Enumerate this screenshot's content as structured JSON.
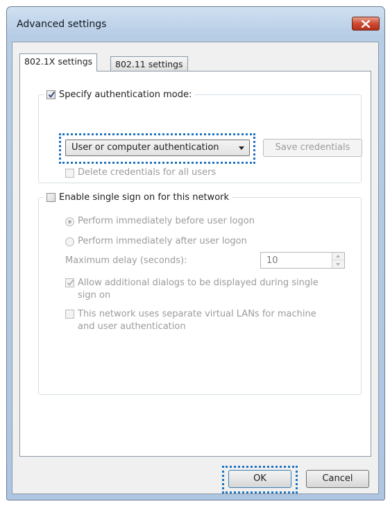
{
  "window": {
    "title": "Advanced settings"
  },
  "tabs": [
    {
      "label": "802.1X settings",
      "active": true
    },
    {
      "label": "802.11 settings",
      "active": false
    }
  ],
  "auth_group": {
    "checkbox_label": "Specify authentication mode:",
    "checked": true,
    "mode_selected": "User or computer authentication",
    "save_credentials_label": "Save credentials",
    "delete_credentials_label": "Delete credentials for all users"
  },
  "sso_group": {
    "checkbox_label": "Enable single sign on for this network",
    "checked": false,
    "radio_before": "Perform immediately before user logon",
    "radio_after": "Perform immediately after user logon",
    "max_delay_label": "Maximum delay (seconds):",
    "max_delay_value": "10",
    "allow_dialogs_line1": "Allow additional dialogs to be displayed during single",
    "allow_dialogs_line2": "sign on",
    "separate_vlans_line1": "This network uses separate virtual LANs for machine",
    "separate_vlans_line2": "and user authentication"
  },
  "buttons": {
    "ok": "OK",
    "cancel": "Cancel"
  },
  "colors": {
    "focus_dots": "#1e73be",
    "close_button": "#cf4a32"
  }
}
